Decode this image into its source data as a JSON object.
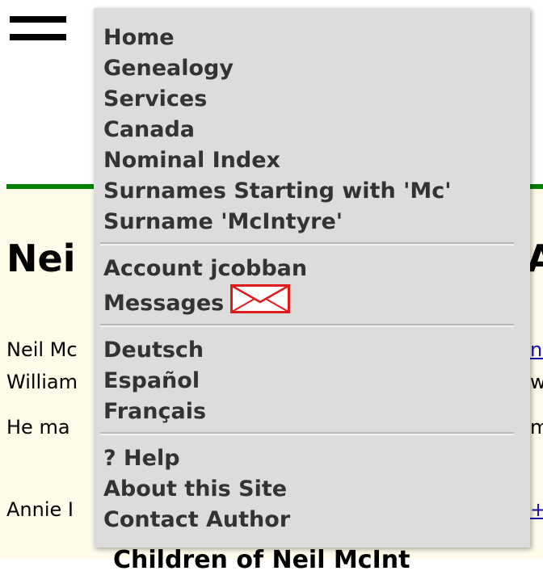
{
  "header": {
    "menu_icon": "hamburger-icon"
  },
  "page": {
    "heading_left": "Nei",
    "heading_right": "A",
    "para1_left": "Neil Mc",
    "para1_right": "nt",
    "para2_left": "William",
    "para2_right": "w",
    "para3_left": "He ma",
    "para3_right": "m",
    "para4_left": "Annie I",
    "para4_right": "+",
    "subheading": "Children of Neil McInt"
  },
  "menu": {
    "nav": [
      {
        "label": "Home"
      },
      {
        "label": "Genealogy"
      },
      {
        "label": "Services"
      },
      {
        "label": "Canada"
      },
      {
        "label": "Nominal Index"
      },
      {
        "label": "Surnames Starting with 'Mc'"
      },
      {
        "label": "Surname 'McIntyre'"
      }
    ],
    "account": {
      "account_label": "Account jcobban",
      "messages_label": "Messages",
      "messages_icon": "envelope-icon"
    },
    "languages": [
      {
        "label": "Deutsch"
      },
      {
        "label": "Español"
      },
      {
        "label": "Français"
      }
    ],
    "help": [
      {
        "label": "? Help"
      },
      {
        "label": "About this Site"
      },
      {
        "label": "Contact Author"
      }
    ]
  },
  "colors": {
    "menu_bg": "#dcdcdc",
    "menu_text": "#333333",
    "rule": "#008000",
    "page_bg": "#fefbe9",
    "envelope": "#e01b1b"
  }
}
